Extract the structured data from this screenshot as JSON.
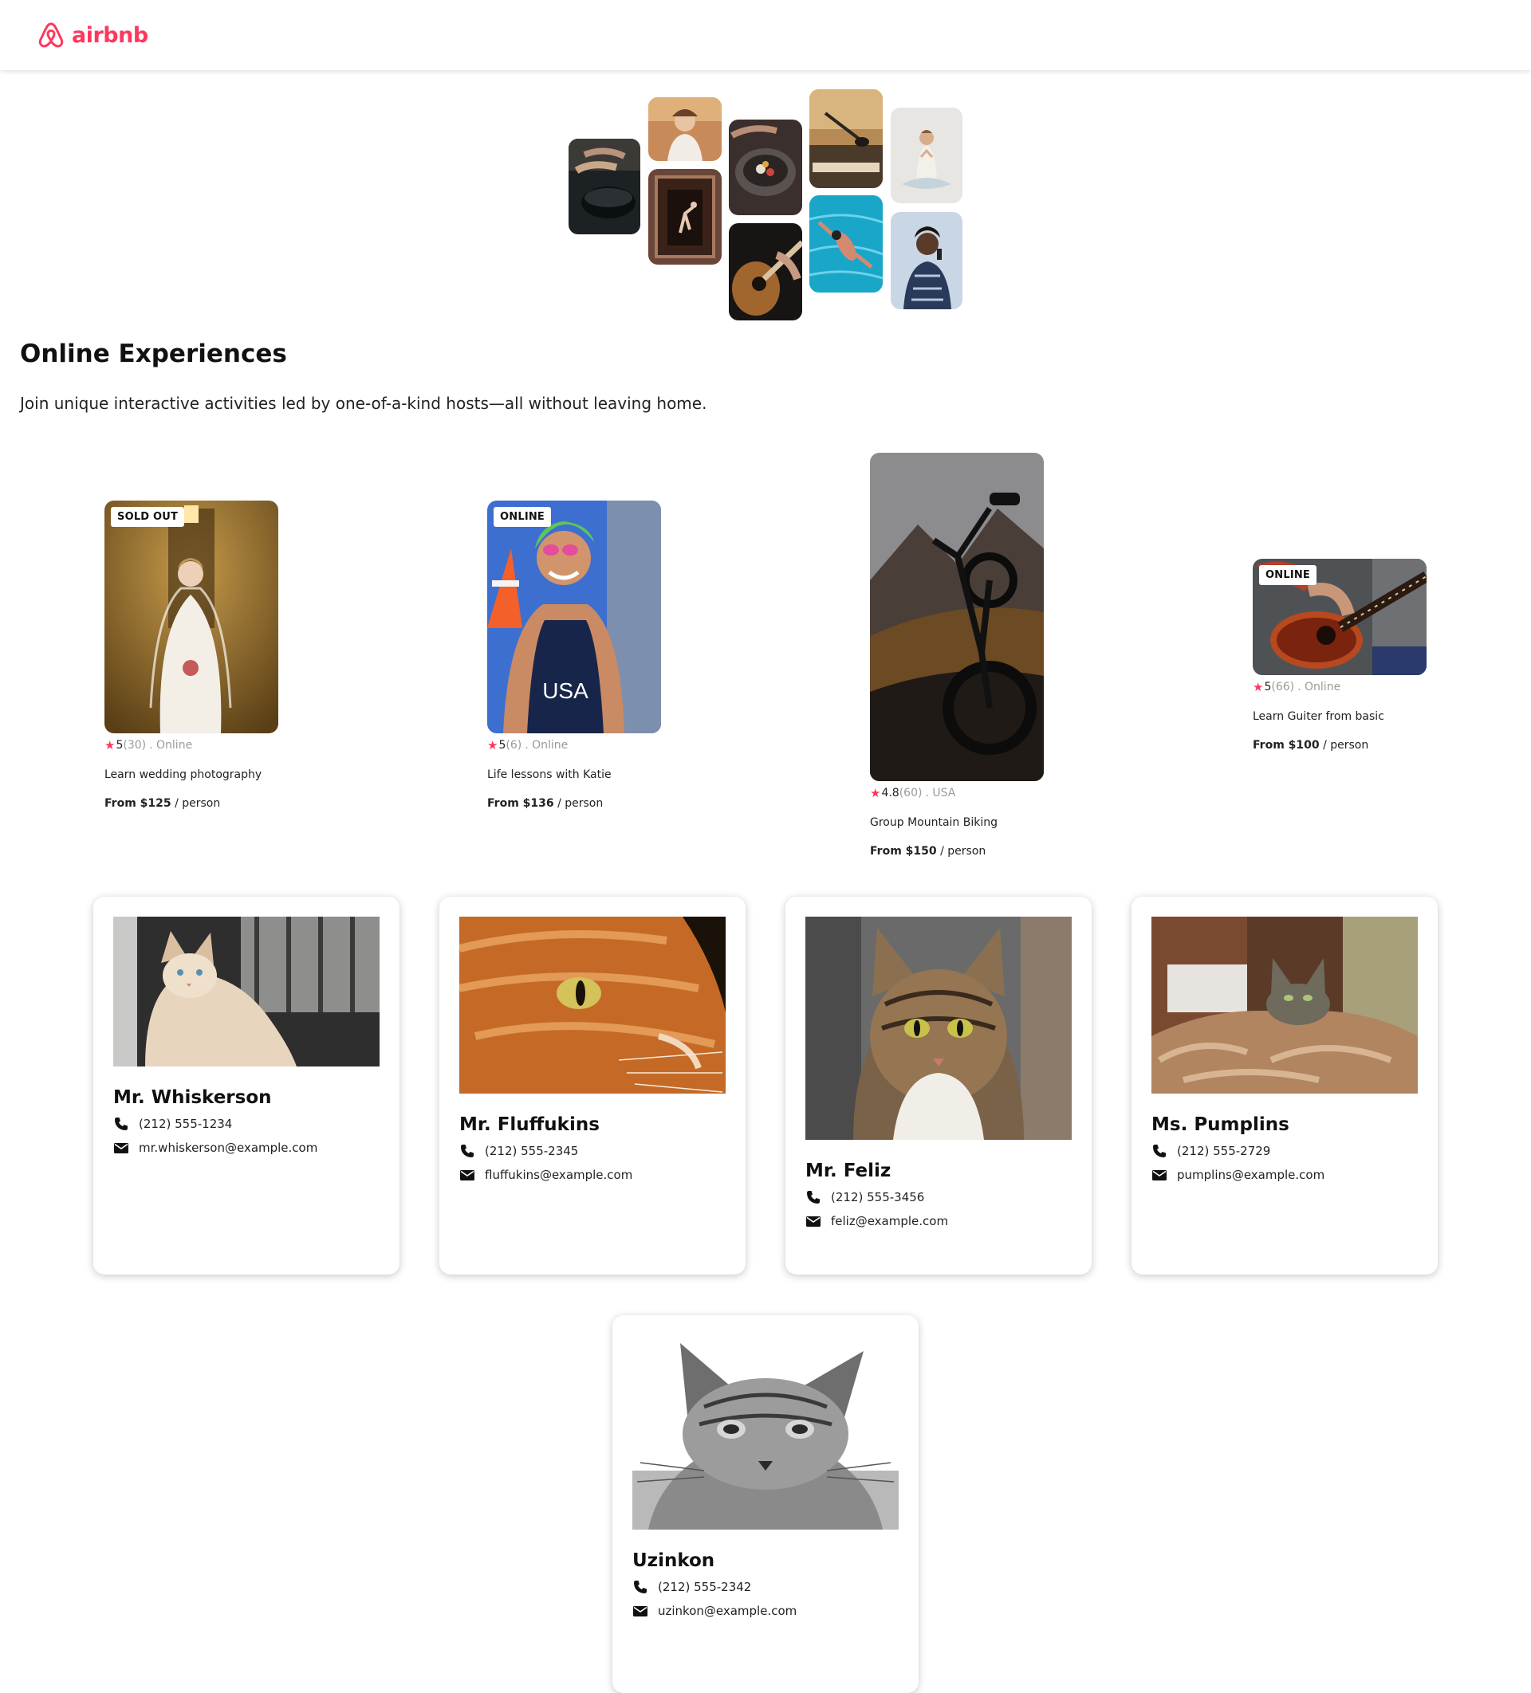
{
  "header": {
    "logo_text": "airbnb",
    "brand_color": "#fe385d"
  },
  "hero": {
    "photos": [
      "pan-photo",
      "woman-portrait-photo",
      "dancer-photo",
      "food-bowl-photo",
      "guitar-photo",
      "microphone-photo",
      "swimmer-photo",
      "yoga-photo",
      "singer-photo"
    ]
  },
  "intro": {
    "title": "Online Experiences",
    "subtitle": "Join unique interactive activities led by one-of-a-kind hosts—all without leaving home."
  },
  "experiences": [
    {
      "badge": "SOLD OUT",
      "rating": "5",
      "reviews": "(30)",
      "location": ". Online",
      "title": "Learn wedding photography",
      "price": "From $125",
      "per": " / person"
    },
    {
      "badge": "ONLINE",
      "rating": "5",
      "reviews": "(6)",
      "location": ". Online",
      "title": "Life lessons with Katie",
      "price": "From $136",
      "per": " / person"
    },
    {
      "badge": "",
      "rating": "4.8",
      "reviews": "(60)",
      "location": ". USA",
      "title": "Group Mountain Biking",
      "price": "From $150",
      "per": " / person"
    },
    {
      "badge": "ONLINE",
      "rating": "5",
      "reviews": "(66)",
      "location": ". Online",
      "title": "Learn Guiter from basic",
      "price": "From $100",
      "per": " / person"
    }
  ],
  "contacts": [
    {
      "name": "Mr. Whiskerson",
      "phone": "(212) 555-1234",
      "email": "mr.whiskerson@example.com"
    },
    {
      "name": "Mr. Fluffukins",
      "phone": "(212) 555-2345",
      "email": "fluffukins@example.com"
    },
    {
      "name": "Mr. Feliz",
      "phone": "(212) 555-3456",
      "email": "feliz@example.com"
    },
    {
      "name": "Ms. Pumplins",
      "phone": "(212) 555-2729",
      "email": "pumplins@example.com"
    },
    {
      "name": "Uzinkon",
      "phone": "(212) 555-2342",
      "email": "uzinkon@example.com"
    }
  ],
  "icons": {
    "logo": "airbnb-logo-icon",
    "phone": "phone-icon",
    "email": "envelope-icon",
    "rating": "star-icon"
  }
}
